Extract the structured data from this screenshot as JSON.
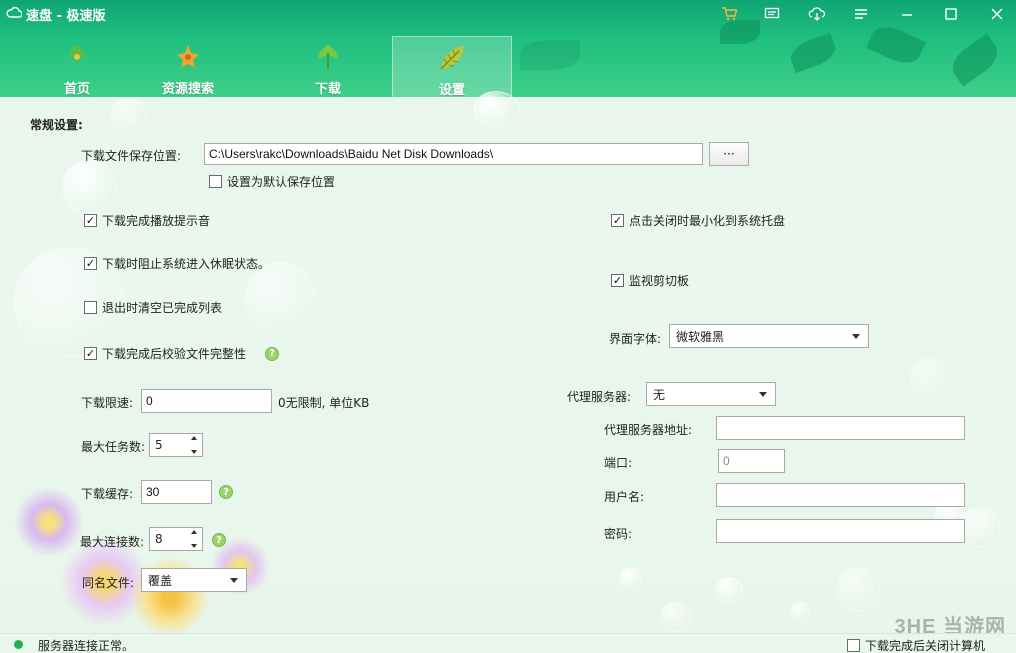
{
  "app": {
    "title": "速盘 - 极速版"
  },
  "nav": {
    "tabs": [
      {
        "label": "首页",
        "icon": "leaf-green-icon"
      },
      {
        "label": "资源搜索",
        "icon": "leaf-orange-icon"
      },
      {
        "label": "下载",
        "icon": "leaf-green-icon"
      },
      {
        "label": "设置",
        "icon": "leaf-yellow-icon",
        "active": true
      }
    ]
  },
  "settings": {
    "section_title": "常规设置:",
    "save_path": {
      "label": "下载文件保存位置:",
      "value": "C:\\Users\\rakc\\Downloads\\Baidu Net Disk Downloads\\",
      "browse_label": "···"
    },
    "set_default": {
      "label": "设置为默认保存位置",
      "checked": false
    },
    "play_sound": {
      "label": "下载完成播放提示音",
      "checked": true
    },
    "prevent_sleep": {
      "label": "下载时阻止系统进入休眠状态。",
      "checked": true
    },
    "clear_on_exit": {
      "label": "退出时清空已完成列表",
      "checked": false
    },
    "verify_integrity": {
      "label": "下载完成后校验文件完整性",
      "checked": true
    },
    "minimize_to_tray": {
      "label": "点击关闭时最小化到系统托盘",
      "checked": true
    },
    "monitor_clipboard": {
      "label": "监视剪切板",
      "checked": true
    },
    "ui_font": {
      "label": "界面字体:",
      "value": "微软雅黑"
    },
    "speed_limit": {
      "label": "下载限速:",
      "value": "0",
      "hint": "0无限制, 单位KB"
    },
    "max_tasks": {
      "label": "最大任务数:",
      "value": "5"
    },
    "cache": {
      "label": "下载缓存:",
      "value": "30"
    },
    "max_conn": {
      "label": "最大连接数:",
      "value": "8"
    },
    "same_name": {
      "label": "同名文件:",
      "value": "覆盖"
    },
    "proxy": {
      "label": "代理服务器:",
      "value": "无"
    },
    "proxy_addr": {
      "label": "代理服务器地址:",
      "value": ""
    },
    "port": {
      "label": "端口:",
      "value": "0"
    },
    "username": {
      "label": "用户名:",
      "value": ""
    },
    "password": {
      "label": "密码:",
      "value": ""
    }
  },
  "status": {
    "text": "服务器连接正常。",
    "shutdown": {
      "label": "下载完成后关闭计算机",
      "checked": false
    }
  },
  "watermark": "3HE 当游网",
  "colors": {
    "nav_green": "#1fbf7f",
    "status_dot": "#23b14d",
    "help_icon": "#9ad46a"
  }
}
